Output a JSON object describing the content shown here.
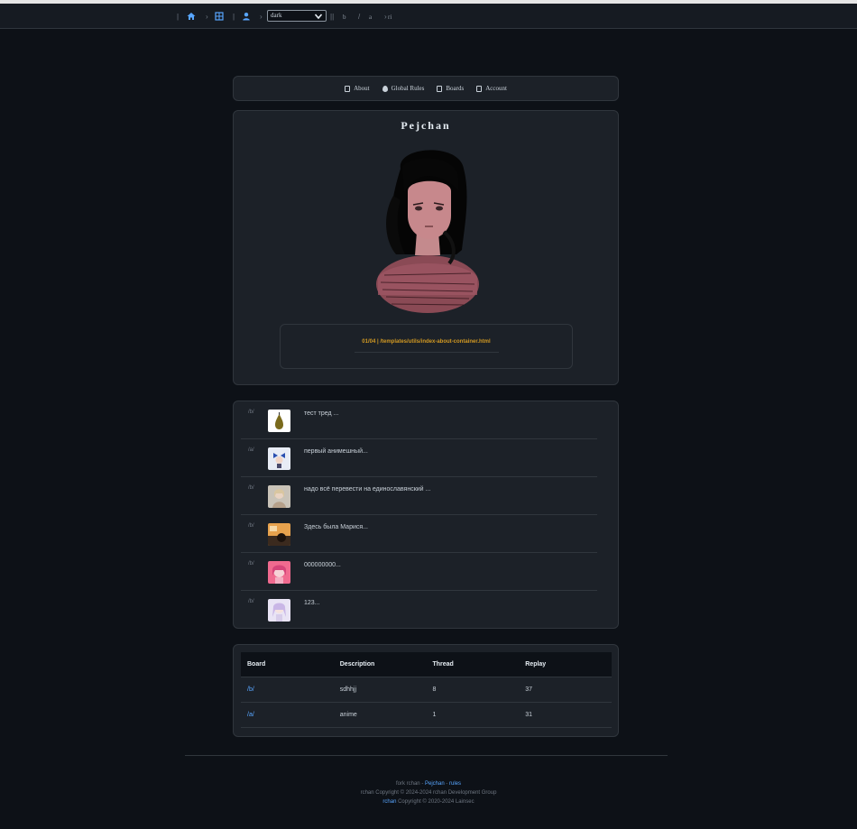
{
  "topbar": {
    "theme_value": "dark",
    "b_label": "b",
    "a_label": "a",
    "c_label": "ri",
    "icons": [
      "home-icon",
      "grid-icon",
      "user-icon"
    ]
  },
  "nav": {
    "items": [
      {
        "label": "About",
        "icon": "document-icon"
      },
      {
        "label": "Global Rules",
        "icon": "drop-icon"
      },
      {
        "label": "Boards",
        "icon": "document-icon"
      },
      {
        "label": "Account",
        "icon": "document-icon"
      }
    ]
  },
  "intro": {
    "title": "Pejchan",
    "notice": "01/04 | /templates/utils/index-about-container.html"
  },
  "threads": [
    {
      "board": "/b/",
      "subject": "тест тред ...",
      "thumb": "pear"
    },
    {
      "board": "/a/",
      "subject": "первый анимешный...",
      "thumb": "chibi-blue"
    },
    {
      "board": "/b/",
      "subject": "надо всё перевести на единославянский ...",
      "thumb": "girl-pale"
    },
    {
      "board": "/b/",
      "subject": "Здесь была Марися...",
      "thumb": "warm-photo"
    },
    {
      "board": "/b/",
      "subject": "000000000...",
      "thumb": "pink-girl"
    },
    {
      "board": "/b/",
      "subject": "123...",
      "thumb": "lavender-girl"
    }
  ],
  "boards": {
    "headers": [
      "Board",
      "Description",
      "Thread",
      "Replay"
    ],
    "rows": [
      {
        "board": "/b/",
        "description": "sdhhjj",
        "thread": "8",
        "replay": "37"
      },
      {
        "board": "/a/",
        "description": "anime",
        "thread": "1",
        "replay": "31"
      }
    ]
  },
  "footer": {
    "line1_prefix": "fork rchan - ",
    "line1_link1": "Pejchan",
    "line1_sep": " - ",
    "line1_link2": "rules",
    "line2": "rchan Copyright © 2024-2024 rchan Development Group",
    "line3_link": "rchan",
    "line3_rest": " Copyright © 2020-2024 Lainsec"
  },
  "colors": {
    "background": "#0d1117",
    "panel": "#1c2128",
    "accent": "#58a6ff",
    "notice": "#d29922"
  }
}
